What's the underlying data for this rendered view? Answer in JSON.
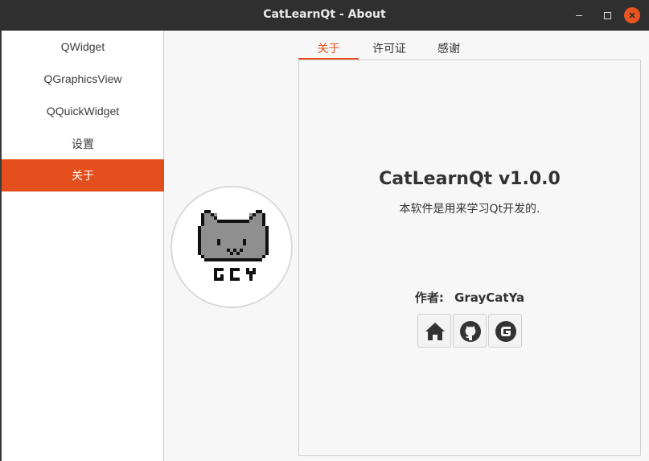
{
  "window": {
    "title": "CatLearnQt - About"
  },
  "sidebar": {
    "items": [
      {
        "label": "QWidget"
      },
      {
        "label": "QGraphicsView"
      },
      {
        "label": "QQuickWidget"
      },
      {
        "label": "设置"
      },
      {
        "label": "关于",
        "active": true
      }
    ]
  },
  "tabs": [
    {
      "label": "关于",
      "active": true
    },
    {
      "label": "许可证"
    },
    {
      "label": "感谢"
    }
  ],
  "about": {
    "app_name": "CatLearnQt  v1.0.0",
    "description": "本软件是用来学习Qt开发的.",
    "author_label": "作者:",
    "author_name": "GrayCatYa",
    "avatar_text": "GCY",
    "links": [
      {
        "icon": "home-icon"
      },
      {
        "icon": "github-icon"
      },
      {
        "icon": "gitee-icon"
      }
    ]
  },
  "colors": {
    "accent": "#e34f1c",
    "titlebar": "#2f2f2f",
    "close": "#e95420"
  }
}
